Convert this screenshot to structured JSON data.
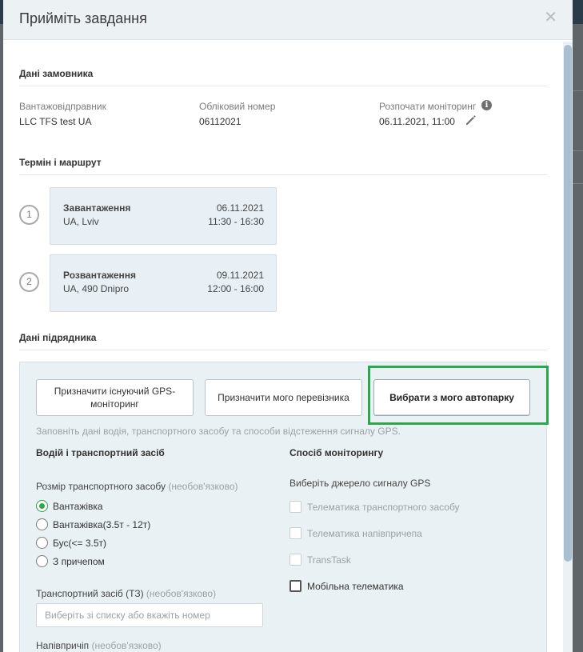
{
  "modal": {
    "title": "Прийміть завдання",
    "close_icon": "close-icon"
  },
  "customer": {
    "section_title": "Дані замовника",
    "shipper_label": "Вантажовідправник",
    "shipper_value": "LLC TFS test UA",
    "account_label": "Обліковий номер",
    "account_value": "06112021",
    "monitoring_label": "Розпочати моніторинг",
    "monitoring_value": "06.11.2021, 11:00"
  },
  "route": {
    "section_title": "Термін і маршрут",
    "stops": [
      {
        "num": "1",
        "title": "Завантаження",
        "place": "UA, Lviv",
        "date": "06.11.2021",
        "time": "11:30 - 16:30"
      },
      {
        "num": "2",
        "title": "Розвантаження",
        "place": "UA, 490 Dnipro",
        "date": "09.11.2021",
        "time": "12:00 - 16:00"
      }
    ]
  },
  "contractor": {
    "section_title": "Дані підрядника",
    "buttons": [
      {
        "label": "Призначити існуючий GPS-моніторинг"
      },
      {
        "label": "Призначити мого перевізника"
      },
      {
        "label": "Вибрати з мого автопарку"
      }
    ],
    "hint": "Заповніть дані водія, транспортного засобу та способи відстеження сигналу GPS.",
    "driver_title": "Водій і транспортний засіб",
    "monitoring_title": "Спосіб моніторингу",
    "size_label": "Розмір транспортного засобу",
    "optional": "(необов'язково)",
    "size_options": [
      "Вантажівка",
      "Вантажівка(3.5т - 12т)",
      "Бус(<= 3.5т)",
      "З причепом"
    ],
    "size_selected": "Вантажівка",
    "gps_label": "Виберіть джерело сигналу GPS",
    "gps_options": [
      "Телематика транспортного засобу",
      "Телематика напівпричепа",
      "TransTask",
      "Мобільна телематика"
    ],
    "vehicle_label": "Транспортний засіб (ТЗ)",
    "vehicle_placeholder": "Виберіть зі списку або вкажіть номер",
    "trailer_label": "Напівпричіп"
  },
  "colors": {
    "accent_green": "#2aa84a",
    "header_bg": "#ecf1f4",
    "panel_bg": "#eaf1f5"
  }
}
